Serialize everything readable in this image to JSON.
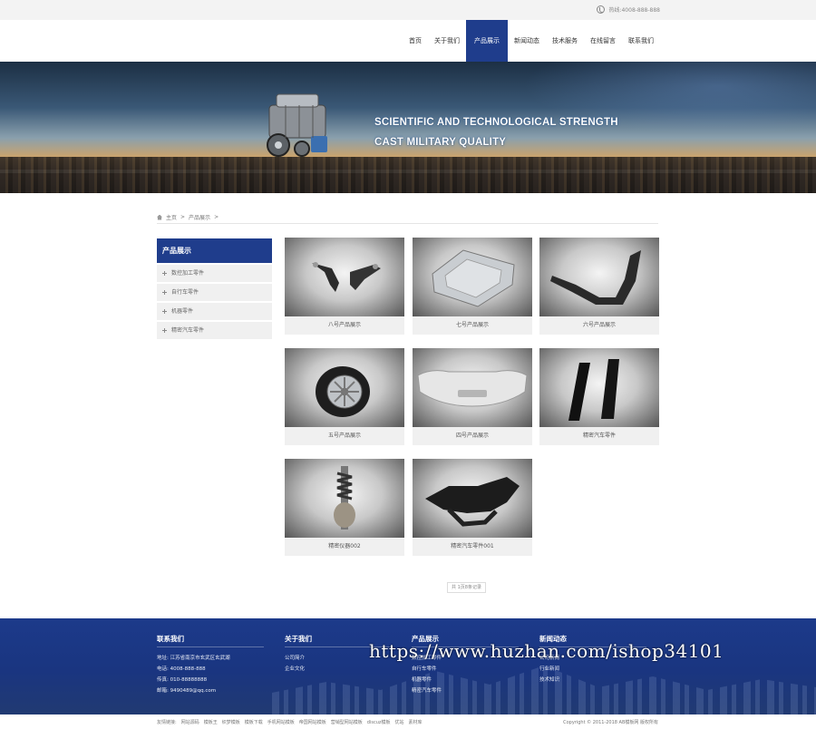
{
  "topbar": {
    "phone": "热线:4008-888-888"
  },
  "nav": [
    {
      "label": "首页",
      "active": false
    },
    {
      "label": "关于我们",
      "active": false
    },
    {
      "label": "产品展示",
      "active": true
    },
    {
      "label": "新闻动态",
      "active": false
    },
    {
      "label": "技术服务",
      "active": false
    },
    {
      "label": "在线留言",
      "active": false
    },
    {
      "label": "联系我们",
      "active": false
    }
  ],
  "banner": {
    "line1": "SCIENTIFIC AND TECHNOLOGICAL STRENGTH",
    "line2": "CAST MILITARY QUALITY"
  },
  "breadcrumb": {
    "home": "主页",
    "sep": ">",
    "current": "产品展示",
    "tail": ">"
  },
  "sidebar": {
    "title": "产品展示",
    "items": [
      "数控加工零件",
      "自行车零件",
      "机器零件",
      "精密汽车零件"
    ]
  },
  "products": [
    {
      "name": "八号产品展示",
      "icon": "suspension-arm-icon"
    },
    {
      "name": "七号产品展示",
      "icon": "body-panel-icon"
    },
    {
      "name": "六号产品展示",
      "icon": "bracket-rail-icon"
    },
    {
      "name": "五号产品展示",
      "icon": "wheel-icon"
    },
    {
      "name": "四号产品展示",
      "icon": "bumper-icon"
    },
    {
      "name": "精密汽车零件",
      "icon": "pillar-trim-icon"
    },
    {
      "name": "精密仪器002",
      "icon": "shock-absorber-icon"
    },
    {
      "name": "精密汽车零件001",
      "icon": "subframe-icon"
    }
  ],
  "pager": "共 1页8条记录",
  "footer": {
    "contact": {
      "title": "联系我们",
      "items": [
        "地址: 江苏省南京市玄武区玄武湖",
        "电话: 4008-888-888",
        "传真: 010-88888888",
        "邮箱: 9490489@qq.com"
      ]
    },
    "about": {
      "title": "关于我们",
      "items": [
        "公司简介",
        "企业文化"
      ]
    },
    "products": {
      "title": "产品展示",
      "items": [
        "数控加工零件",
        "自行车零件",
        "机器零件",
        "精密汽车零件"
      ]
    },
    "news": {
      "title": "新闻动态",
      "items": [
        "公司新闻",
        "行业新闻",
        "技术知识"
      ]
    }
  },
  "watermark": "https://www.huzhan.com/ishop34101",
  "bottom": {
    "links": [
      "友情链接:",
      "网站源码",
      "模板王",
      "织梦模板",
      "模板下载",
      "手机网站模板",
      "帝国网站模板",
      "营销型网站模板",
      "discuz模板",
      "优站",
      "素材库"
    ],
    "copyright": "Copyright © 2011-2018 AB模板网 版权所有"
  }
}
